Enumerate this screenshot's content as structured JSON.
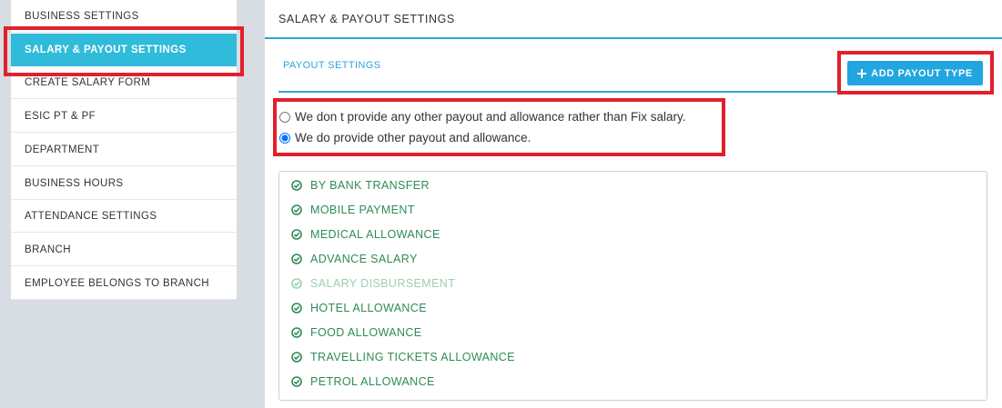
{
  "sidebar": {
    "items": [
      {
        "label": "BUSINESS SETTINGS",
        "name": "sidebar-item-business-settings"
      },
      {
        "label": "SALARY & PAYOUT SETTINGS",
        "name": "sidebar-item-salary-payout-settings",
        "active": true
      },
      {
        "label": "CREATE SALARY FORM",
        "name": "sidebar-item-create-salary-form"
      },
      {
        "label": "ESIC PT & PF",
        "name": "sidebar-item-esic-pt-pf"
      },
      {
        "label": "DEPARTMENT",
        "name": "sidebar-item-department"
      },
      {
        "label": "BUSINESS HOURS",
        "name": "sidebar-item-business-hours"
      },
      {
        "label": "ATTENDANCE SETTINGS",
        "name": "sidebar-item-attendance-settings"
      },
      {
        "label": "BRANCH",
        "name": "sidebar-item-branch"
      },
      {
        "label": "EMPLOYEE BELONGS TO BRANCH",
        "name": "sidebar-item-employee-belongs-to-branch"
      }
    ]
  },
  "main": {
    "title": "SALARY & PAYOUT SETTINGS",
    "subtitle": "PAYOUT SETTINGS",
    "add_button_label": "ADD PAYOUT TYPE",
    "add_button_icon": "plus-icon",
    "options": [
      {
        "label": "We don t provide any other payout and allowance rather than Fix salary.",
        "checked": false
      },
      {
        "label": "We do provide other payout and allowance.",
        "checked": true
      }
    ],
    "payout_types": [
      {
        "label": "BY BANK TRANSFER",
        "enabled": true
      },
      {
        "label": "MOBILE PAYMENT",
        "enabled": true
      },
      {
        "label": "MEDICAL ALLOWANCE",
        "enabled": true
      },
      {
        "label": "ADVANCE SALARY",
        "enabled": true
      },
      {
        "label": "SALARY DISBURSEMENT",
        "enabled": false
      },
      {
        "label": "HOTEL ALLOWANCE",
        "enabled": true
      },
      {
        "label": "FOOD ALLOWANCE",
        "enabled": true
      },
      {
        "label": "TRAVELLING TICKETS ALLOWANCE",
        "enabled": true
      },
      {
        "label": "PETROL ALLOWANCE",
        "enabled": true
      }
    ]
  },
  "colors": {
    "accent": "#2fa4d9",
    "active_sidebar": "#2fbbd9",
    "button": "#22a6e0",
    "highlight": "#e2202c",
    "payout_text": "#2e8b57",
    "payout_text_disabled": "#9ccfb0"
  }
}
